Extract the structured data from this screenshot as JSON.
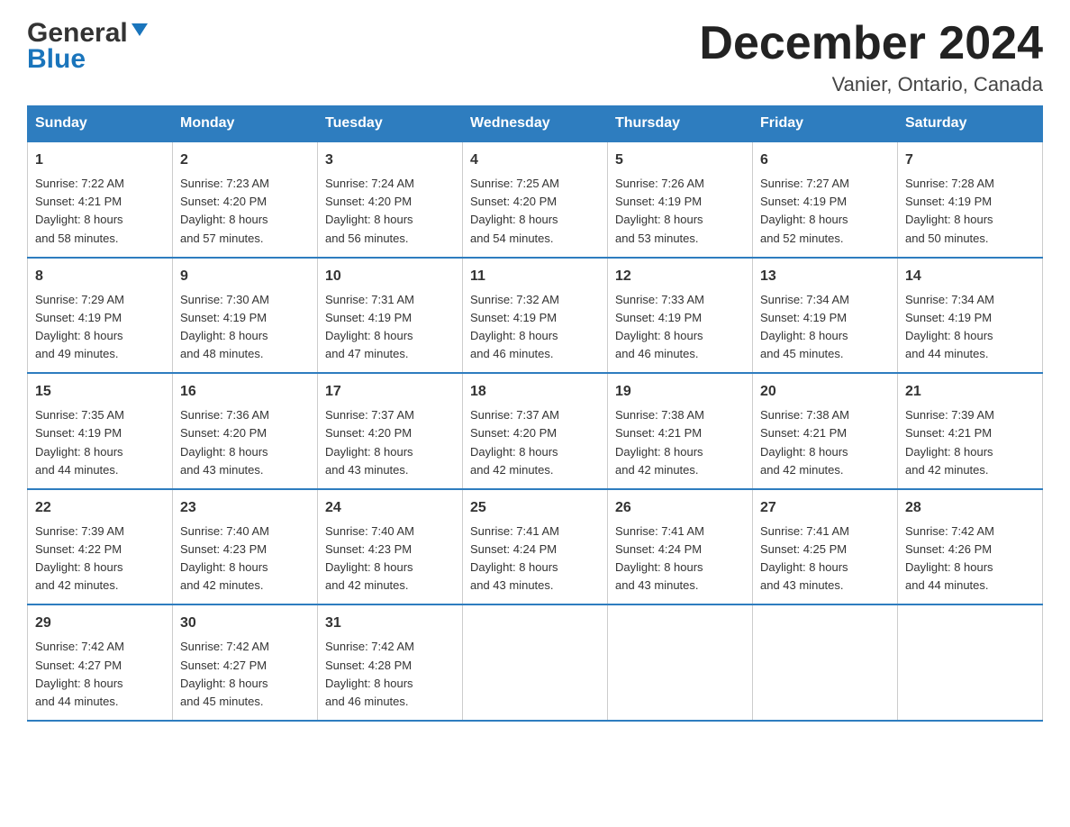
{
  "header": {
    "logo_general": "General",
    "logo_blue": "Blue",
    "month_title": "December 2024",
    "location": "Vanier, Ontario, Canada"
  },
  "days_of_week": [
    "Sunday",
    "Monday",
    "Tuesday",
    "Wednesday",
    "Thursday",
    "Friday",
    "Saturday"
  ],
  "weeks": [
    [
      {
        "day": "1",
        "sunrise": "7:22 AM",
        "sunset": "4:21 PM",
        "daylight": "8 hours and 58 minutes."
      },
      {
        "day": "2",
        "sunrise": "7:23 AM",
        "sunset": "4:20 PM",
        "daylight": "8 hours and 57 minutes."
      },
      {
        "day": "3",
        "sunrise": "7:24 AM",
        "sunset": "4:20 PM",
        "daylight": "8 hours and 56 minutes."
      },
      {
        "day": "4",
        "sunrise": "7:25 AM",
        "sunset": "4:20 PM",
        "daylight": "8 hours and 54 minutes."
      },
      {
        "day": "5",
        "sunrise": "7:26 AM",
        "sunset": "4:19 PM",
        "daylight": "8 hours and 53 minutes."
      },
      {
        "day": "6",
        "sunrise": "7:27 AM",
        "sunset": "4:19 PM",
        "daylight": "8 hours and 52 minutes."
      },
      {
        "day": "7",
        "sunrise": "7:28 AM",
        "sunset": "4:19 PM",
        "daylight": "8 hours and 50 minutes."
      }
    ],
    [
      {
        "day": "8",
        "sunrise": "7:29 AM",
        "sunset": "4:19 PM",
        "daylight": "8 hours and 49 minutes."
      },
      {
        "day": "9",
        "sunrise": "7:30 AM",
        "sunset": "4:19 PM",
        "daylight": "8 hours and 48 minutes."
      },
      {
        "day": "10",
        "sunrise": "7:31 AM",
        "sunset": "4:19 PM",
        "daylight": "8 hours and 47 minutes."
      },
      {
        "day": "11",
        "sunrise": "7:32 AM",
        "sunset": "4:19 PM",
        "daylight": "8 hours and 46 minutes."
      },
      {
        "day": "12",
        "sunrise": "7:33 AM",
        "sunset": "4:19 PM",
        "daylight": "8 hours and 46 minutes."
      },
      {
        "day": "13",
        "sunrise": "7:34 AM",
        "sunset": "4:19 PM",
        "daylight": "8 hours and 45 minutes."
      },
      {
        "day": "14",
        "sunrise": "7:34 AM",
        "sunset": "4:19 PM",
        "daylight": "8 hours and 44 minutes."
      }
    ],
    [
      {
        "day": "15",
        "sunrise": "7:35 AM",
        "sunset": "4:19 PM",
        "daylight": "8 hours and 44 minutes."
      },
      {
        "day": "16",
        "sunrise": "7:36 AM",
        "sunset": "4:20 PM",
        "daylight": "8 hours and 43 minutes."
      },
      {
        "day": "17",
        "sunrise": "7:37 AM",
        "sunset": "4:20 PM",
        "daylight": "8 hours and 43 minutes."
      },
      {
        "day": "18",
        "sunrise": "7:37 AM",
        "sunset": "4:20 PM",
        "daylight": "8 hours and 42 minutes."
      },
      {
        "day": "19",
        "sunrise": "7:38 AM",
        "sunset": "4:21 PM",
        "daylight": "8 hours and 42 minutes."
      },
      {
        "day": "20",
        "sunrise": "7:38 AM",
        "sunset": "4:21 PM",
        "daylight": "8 hours and 42 minutes."
      },
      {
        "day": "21",
        "sunrise": "7:39 AM",
        "sunset": "4:21 PM",
        "daylight": "8 hours and 42 minutes."
      }
    ],
    [
      {
        "day": "22",
        "sunrise": "7:39 AM",
        "sunset": "4:22 PM",
        "daylight": "8 hours and 42 minutes."
      },
      {
        "day": "23",
        "sunrise": "7:40 AM",
        "sunset": "4:23 PM",
        "daylight": "8 hours and 42 minutes."
      },
      {
        "day": "24",
        "sunrise": "7:40 AM",
        "sunset": "4:23 PM",
        "daylight": "8 hours and 42 minutes."
      },
      {
        "day": "25",
        "sunrise": "7:41 AM",
        "sunset": "4:24 PM",
        "daylight": "8 hours and 43 minutes."
      },
      {
        "day": "26",
        "sunrise": "7:41 AM",
        "sunset": "4:24 PM",
        "daylight": "8 hours and 43 minutes."
      },
      {
        "day": "27",
        "sunrise": "7:41 AM",
        "sunset": "4:25 PM",
        "daylight": "8 hours and 43 minutes."
      },
      {
        "day": "28",
        "sunrise": "7:42 AM",
        "sunset": "4:26 PM",
        "daylight": "8 hours and 44 minutes."
      }
    ],
    [
      {
        "day": "29",
        "sunrise": "7:42 AM",
        "sunset": "4:27 PM",
        "daylight": "8 hours and 44 minutes."
      },
      {
        "day": "30",
        "sunrise": "7:42 AM",
        "sunset": "4:27 PM",
        "daylight": "8 hours and 45 minutes."
      },
      {
        "day": "31",
        "sunrise": "7:42 AM",
        "sunset": "4:28 PM",
        "daylight": "8 hours and 46 minutes."
      },
      null,
      null,
      null,
      null
    ]
  ],
  "labels": {
    "sunrise": "Sunrise:",
    "sunset": "Sunset:",
    "daylight": "Daylight:"
  }
}
